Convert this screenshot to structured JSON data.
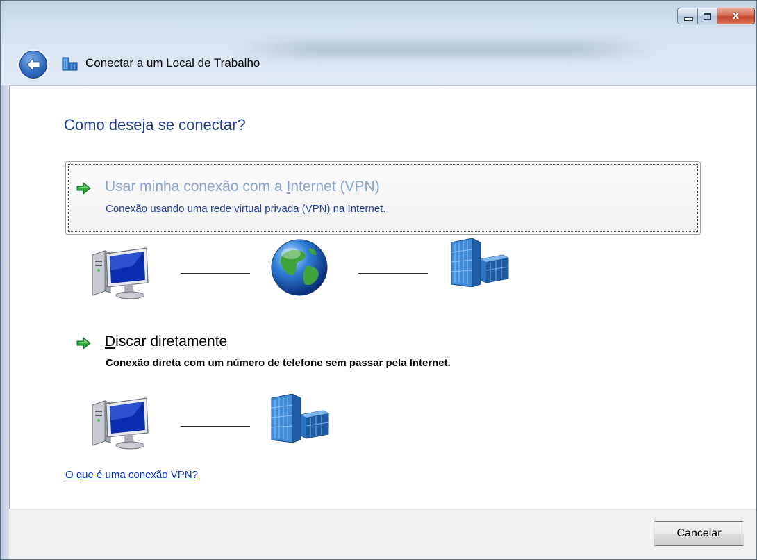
{
  "window": {
    "title": "Conectar a um Local de Trabalho",
    "close_glyph": "x"
  },
  "main": {
    "heading": "Como deseja se conectar?"
  },
  "options": [
    {
      "title_pre": "Usar minha conexão com a ",
      "title_accel": "I",
      "title_post": "nternet (VPN)",
      "description": "Conexão usando uma rede virtual privada (VPN) na Internet.",
      "icons": [
        "computer-icon",
        "globe-icon",
        "building-icon"
      ],
      "highlighted": true
    },
    {
      "title_pre": "",
      "title_accel": "D",
      "title_post": "iscar diretamente",
      "description": "Conexão direta com um número de telefone sem passar pela Internet.",
      "icons": [
        "computer-icon",
        "building-icon"
      ],
      "highlighted": false
    }
  ],
  "help_link": "O que é uma conexão VPN?",
  "footer": {
    "cancel_label": "Cancelar"
  },
  "colors": {
    "heading": "#1e3c8a",
    "option_hover_title": "#8aa5cc",
    "option_hover_desc": "#1f3f9a",
    "link": "#0033cc",
    "arrow_green": "#2da63a",
    "close_red": "#c2452a"
  }
}
